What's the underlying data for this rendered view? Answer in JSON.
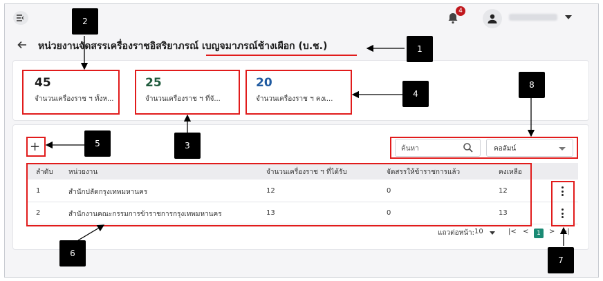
{
  "header": {
    "menu_icon": "menu-collapse-icon",
    "notification_icon": "bell-icon",
    "notification_count": "4",
    "user_icon": "person-icon"
  },
  "page": {
    "back_icon": "arrow-left-icon",
    "title": "หน่วยงานจัดสรรเครื่องราชอิสริยาภรณ์ เบญจมาภรณ์ช้างเผือก (บ.ช.)"
  },
  "stats": [
    {
      "value": "45",
      "label": "จำนวนเครื่องราช ฯ ทั้งห...",
      "color": "#1b1b1b"
    },
    {
      "value": "25",
      "label": "จำนวนเครื่องราช ฯ ที่จั...",
      "color": "#1f5a3c"
    },
    {
      "value": "20",
      "label": "จำนวนเครื่องราช ฯ คงเ...",
      "color": "#1f5aa0"
    }
  ],
  "toolbar": {
    "add_label": "+",
    "search_placeholder": "ค้นหา",
    "column_select_label": "คอลัมน์"
  },
  "table": {
    "columns": [
      "ลำดับ",
      "หน่วยงาน",
      "จำนวนเครื่องราช ฯ ที่ได้รับ",
      "จัดสรรให้ข้าราชการแล้ว",
      "คงเหลือ"
    ],
    "rows": [
      [
        "1",
        "สำนักปลัดกรุงเทพมหานคร",
        "12",
        "0",
        "12"
      ],
      [
        "2",
        "สำนักงานคณะกรรมการข้าราชการกรุงเทพมหานคร",
        "13",
        "0",
        "13"
      ]
    ]
  },
  "pagination": {
    "rows_per_page_label": "แถวต่อหน้า:",
    "rows_per_page_value": "10",
    "first_label": "|<",
    "prev_label": "<",
    "current_page": "1",
    "next_label": ">",
    "last_label": ">|"
  },
  "callouts": [
    "1",
    "2",
    "3",
    "4",
    "5",
    "6",
    "7",
    "8"
  ],
  "colors": {
    "accent": "#1a8a74",
    "highlight": "#e11b1b",
    "badge": "#c0171d"
  }
}
